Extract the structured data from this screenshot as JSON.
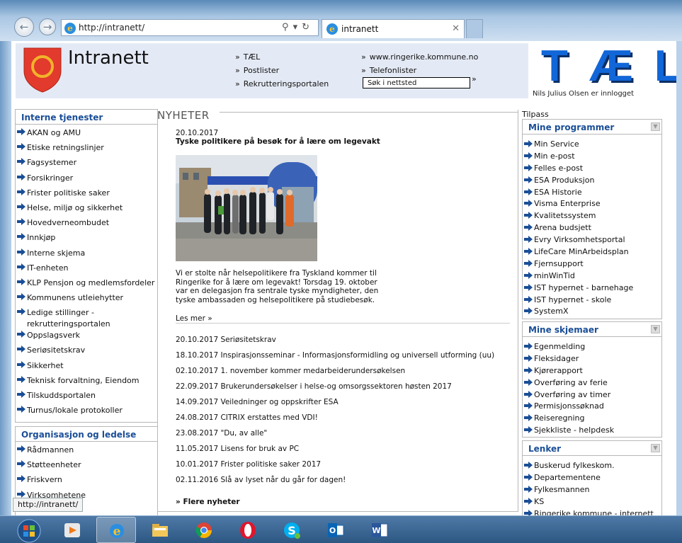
{
  "browser": {
    "address_url": "http://intranett/",
    "tab_title": "intranett",
    "status_url": "http://intranett/"
  },
  "header": {
    "site_title": "Intranett",
    "links_col1": [
      "TÆL",
      "Postlister",
      "Rekrutteringsportalen"
    ],
    "links_col2": [
      "www.ringerike.kommune.no",
      "Telefonlister"
    ],
    "search_placeholder": "Søk i nettsted",
    "logo_text": "TÆL",
    "logged_in": "Nils Julius Olsen er innlogget"
  },
  "left": {
    "interne_title": "Interne tjenester",
    "interne": [
      "AKAN og AMU",
      "Etiske retningslinjer",
      "Fagsystemer",
      "Forsikringer",
      "Frister politiske saker",
      "Helse, miljø og sikkerhet",
      "Hovedverneombudet",
      "Innkjøp",
      "Interne skjema",
      "IT-enheten",
      "KLP Pensjon og medlemsfordeler",
      "Kommunens utleiehytter",
      "Ledige stillinger -",
      "Oppslagsverk",
      "Seriøsitetskrav",
      "Sikkerhet",
      "Teknisk forvaltning, Eiendom",
      "Tilskuddsportalen",
      "Turnus/lokale protokoller"
    ],
    "ledige_line2": "rekrutteringsportalen",
    "org_title": "Organisasjon og ledelse",
    "org": [
      "Rådmannen",
      "Støtteenheter",
      "Friskvern",
      "Virksomhetene"
    ]
  },
  "news": {
    "heading": "NYHETER",
    "featured": {
      "date": "20.10.2017",
      "title": "Tyske politikere på besøk for å lære om legevakt",
      "text1": "Vi er stolte når helsepolitikere fra Tyskland kommer til",
      "text2": "Ringerike for å lære om legevakt! Torsdag 19. oktober",
      "text3": "var en delegasjon fra sentrale tyske myndigheter, den",
      "text4": "tyske ambassaden og helsepolitikere på studiebesøk.",
      "read_more": "Les mer »"
    },
    "items": [
      {
        "date": "20.10.2017",
        "title": "Seriøsitetskrav"
      },
      {
        "date": "18.10.2017",
        "title": "Inspirasjonsseminar - Informasjonsformidling og universell utforming (uu)"
      },
      {
        "date": "02.10.2017",
        "title": "1. november kommer medarbeiderundersøkelsen"
      },
      {
        "date": "22.09.2017",
        "title": "Brukerundersøkelser i helse-og omsorgssektoren høsten 2017"
      },
      {
        "date": "14.09.2017",
        "title": "Veiledninger og oppskrifter ESA"
      },
      {
        "date": "24.08.2017",
        "title": "CITRIX erstattes med VDI!"
      },
      {
        "date": "23.08.2017",
        "title": "\"Du, av alle\""
      },
      {
        "date": "11.05.2017",
        "title": "Lisens for bruk av PC"
      },
      {
        "date": "10.01.2017",
        "title": "Frister politiske saker 2017"
      },
      {
        "date": "02.11.2016",
        "title": "Slå av lyset når du går for dagen!"
      }
    ],
    "more": "Flere nyheter"
  },
  "right": {
    "tilpass": "Tilpass",
    "prog_title": "Mine programmer",
    "programs": [
      "Min Service",
      "Min e-post",
      "Felles e-post",
      "ESA Produksjon",
      "ESA Historie",
      "Visma Enterprise",
      "Kvalitetssystem",
      "Arena budsjett",
      "Evry Virksomhetsportal",
      "LifeCare MinArbeidsplan",
      "Fjernsupport",
      "minWinTid",
      "IST hypernet - barnehage",
      "IST hypernet - skole",
      "SystemX"
    ],
    "skjema_title": "Mine skjemaer",
    "skjema": [
      "Egenmelding",
      "Fleksidager",
      "Kjørerapport",
      "Overføring av ferie",
      "Overføring av timer",
      "Permisjonssøknad",
      "Reiseregning",
      "Sjekkliste - helpdesk"
    ],
    "lenker_title": "Lenker",
    "lenker": [
      "Buskerud fylkeskom.",
      "Departementene",
      "Fylkesmannen",
      "KS",
      "Ringerike kommune - internett"
    ]
  },
  "colors": {
    "accent": "#1a4e97",
    "logo_blue": "#1166d8",
    "crest_red": "#e23a2c",
    "crest_gold": "#f2b32a"
  }
}
